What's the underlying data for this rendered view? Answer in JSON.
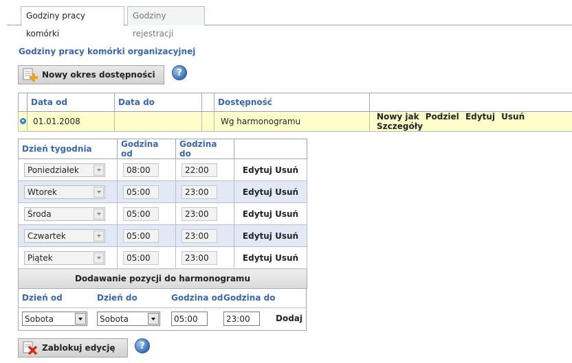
{
  "tabs": [
    {
      "label": "Godziny pracy komórki"
    },
    {
      "label": "Godziny rejestracji"
    }
  ],
  "section_title": "Godziny pracy komórki organizacyjnej",
  "new_period_button": "Nowy okres dostępności",
  "help_label": "?",
  "periods_table": {
    "headers": [
      "Data od",
      "Data do",
      "Dostępność"
    ],
    "rows": [
      {
        "date_from": "01.01.2008",
        "date_to": "",
        "availability": "Wg harmonogramu",
        "actions": [
          "Nowy jak",
          "Podziel",
          "Edytuj",
          "Usuń",
          "Szczegóły"
        ]
      }
    ]
  },
  "schedule": {
    "headers": [
      "Dzień tygodnia",
      "Godzina od",
      "Godzina do"
    ],
    "rows": [
      {
        "day": "Poniedziałek",
        "from": "08:00",
        "to": "22:00",
        "edit": "Edytuj",
        "delete": "Usuń"
      },
      {
        "day": "Wtorek",
        "from": "05:00",
        "to": "23:00",
        "edit": "Edytuj",
        "delete": "Usuń"
      },
      {
        "day": "Środa",
        "from": "05:00",
        "to": "23:00",
        "edit": "Edytuj",
        "delete": "Usuń"
      },
      {
        "day": "Czwartek",
        "from": "05:00",
        "to": "23:00",
        "edit": "Edytuj",
        "delete": "Usuń"
      },
      {
        "day": "Piątek",
        "from": "05:00",
        "to": "23:00",
        "edit": "Edytuj",
        "delete": "Usuń"
      }
    ],
    "add_section_title": "Dodawanie pozycji do harmonogramu",
    "add_labels": {
      "day_from": "Dzień od",
      "day_to": "Dzień do",
      "time_from": "Godzina od",
      "time_to": "Godzina do"
    },
    "add_values": {
      "day_from": "Sobota",
      "day_to": "Sobota",
      "time_from": "05:00",
      "time_to": "23:00"
    },
    "add_button": "Dodaj"
  },
  "block_edit_button": "Zablokuj edycję",
  "colors": {
    "accent": "#3a67a8",
    "selected_row": "#ffffcc",
    "alt_row": "#e2e9f6"
  }
}
